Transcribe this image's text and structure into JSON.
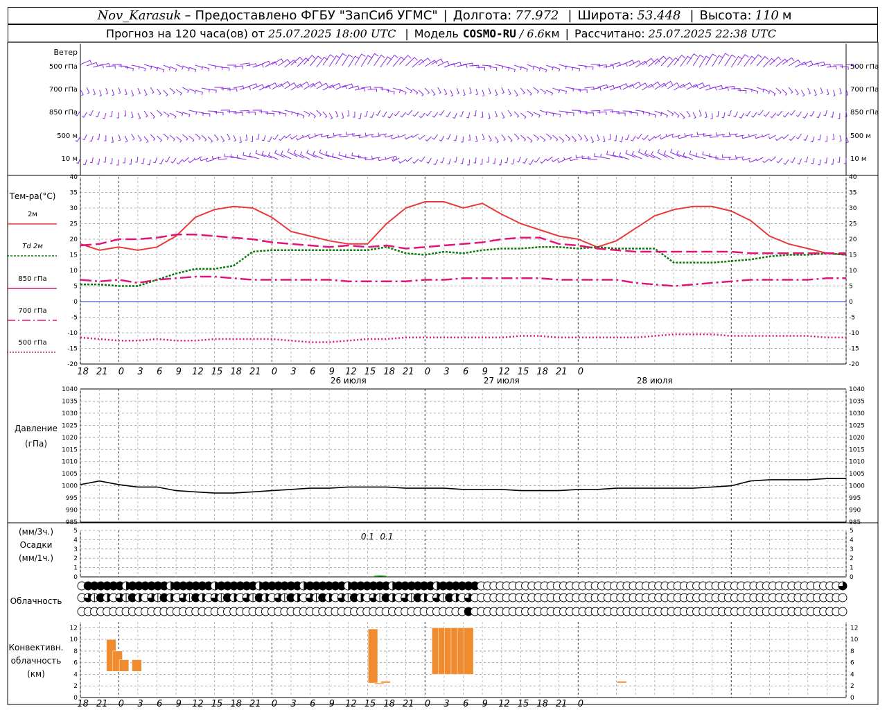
{
  "header": {
    "station": "Nov_Karasuk",
    "dash": "–",
    "provider": "Предоставлено ФГБУ \"ЗапСиб УГМС\"",
    "lon_label": "Долгота:",
    "lon_value": "77.972",
    "lat_label": "Широта:",
    "lat_value": "53.448",
    "alt_label": "Высота:",
    "alt_value": "110",
    "alt_unit": "м",
    "forecast_label": "Прогноз на 120 часа(ов) от",
    "forecast_start": "25.07.2025 18:00 UTC",
    "model_label": "Модель",
    "model_name": "COSMO-RU",
    "model_res": "/ 6.6",
    "model_res_unit": "км",
    "calc_label": "Рассчитано:",
    "calc_time": "25.07.2025 22:38 UTC"
  },
  "colors": {
    "t2m": "#e83a3a",
    "td2m": "#0a7a0a",
    "t850": "#e0147a",
    "t700": "#e0147a",
    "t500": "#e0147a",
    "wind": "#8a2be2",
    "pressure": "#000000",
    "precip": "#0a9a0a",
    "convective": "#f08c30",
    "zero_line": "#2030d0"
  },
  "x_axis": {
    "tick_labels": [
      "18",
      "21",
      "0",
      "3",
      "6",
      "9",
      "12",
      "15",
      "18",
      "21",
      "0",
      "3",
      "6",
      "9",
      "12",
      "15",
      "18",
      "21",
      "0",
      "3",
      "6",
      "9",
      "12",
      "15",
      "18",
      "21",
      "0"
    ],
    "day_labels": [
      "26 июля",
      "27 июля",
      "28 июля"
    ]
  },
  "wind_panel": {
    "title": "Ветер",
    "levels": [
      "500 гПа",
      "700 гПа",
      "850 гПа",
      "500 м",
      "10 м"
    ]
  },
  "temp_panel": {
    "title": "Тем-ра(°C)",
    "legend": [
      "2м",
      "Td 2м",
      "850 гПа",
      "700 гПа",
      "500 гПа"
    ],
    "yticks": [
      40,
      35,
      30,
      25,
      20,
      15,
      10,
      5,
      0,
      -5,
      -10,
      -15,
      -20
    ]
  },
  "pressure_panel": {
    "title": "Давление",
    "unit": "(гПа)",
    "yticks": [
      1040,
      1035,
      1030,
      1025,
      1020,
      1015,
      1010,
      1005,
      1000,
      995,
      990,
      985
    ]
  },
  "precip_panel": {
    "unit1": "(мм/3ч.)",
    "title": "Осадки",
    "unit2": "(мм/1ч.)",
    "yticks": [
      5,
      4,
      3,
      2,
      1,
      0
    ],
    "labels": [
      "0.1",
      "0.1"
    ]
  },
  "cloud_panel": {
    "title": "Облачность"
  },
  "conv_panel": {
    "title_lines": [
      "Конвективн.",
      "облачность",
      "(км)"
    ],
    "yticks": [
      12,
      10,
      8,
      6,
      4,
      2,
      0
    ]
  },
  "chart_data": [
    {
      "type": "line",
      "title": "Тем-ра(°C)",
      "x_hours_from_start": [
        0,
        3,
        6,
        9,
        12,
        15,
        18,
        21,
        24,
        27,
        30,
        33,
        36,
        39,
        42,
        45,
        48,
        51,
        54,
        57,
        60,
        63,
        66,
        69,
        72,
        75,
        78,
        81,
        84,
        87,
        90,
        93,
        96,
        99,
        102,
        105,
        108,
        111,
        114,
        117,
        120
      ],
      "ylim": [
        -20,
        40
      ],
      "series": [
        {
          "name": "2м",
          "values": [
            18.5,
            16.5,
            17.5,
            16.5,
            17.5,
            21,
            27,
            29.5,
            30.5,
            30,
            27,
            22.5,
            21,
            19.5,
            18.5,
            18.5,
            25,
            30,
            32,
            32,
            30,
            31.5,
            28,
            25,
            23,
            21,
            20,
            17.5,
            19.5,
            23.5,
            27.5,
            29.5,
            30.5,
            30.5,
            29,
            26,
            21,
            18.5,
            17,
            15.5,
            15
          ]
        },
        {
          "name": "Td 2м",
          "values": [
            5.5,
            5.5,
            5,
            5,
            7,
            9,
            10.5,
            10.5,
            11.5,
            16,
            16.5,
            16.5,
            16.5,
            16.5,
            16.5,
            16.5,
            17.5,
            15.5,
            15,
            16,
            15.5,
            16.5,
            17,
            17,
            17.5,
            17.5,
            17,
            17.5,
            17,
            17,
            17,
            12.5,
            12.5,
            12.5,
            13,
            13.5,
            14.5,
            15,
            15,
            15.5,
            15
          ]
        },
        {
          "name": "850 гПа",
          "values": [
            18,
            18.5,
            20,
            20,
            20.5,
            21.5,
            21.5,
            21,
            20.5,
            20,
            19,
            18.5,
            18,
            17.5,
            18,
            17.5,
            18,
            17,
            17.5,
            18,
            18.5,
            19,
            20,
            20.5,
            20.5,
            18.5,
            18,
            17,
            16.5,
            16,
            16,
            16,
            16,
            16,
            16,
            15.5,
            15.5,
            15.5,
            15.5,
            15.5,
            15.5
          ]
        },
        {
          "name": "700 гПа",
          "values": [
            7,
            6.5,
            7,
            6,
            7,
            7.5,
            8,
            8,
            7.5,
            7,
            7,
            7,
            7,
            7,
            6.5,
            6.5,
            6.5,
            6.5,
            7,
            7,
            7.5,
            7.5,
            7.5,
            7.5,
            7.5,
            7,
            7,
            7,
            7,
            6,
            5.5,
            5,
            5.5,
            6,
            6.5,
            7,
            7,
            7,
            7,
            7.5,
            7.5
          ]
        },
        {
          "name": "500 гПа",
          "values": [
            -11.5,
            -12,
            -12.5,
            -12.5,
            -12,
            -12.5,
            -12.5,
            -12,
            -12,
            -12,
            -12,
            -12.5,
            -13,
            -13,
            -12.5,
            -12,
            -12,
            -11.5,
            -11.5,
            -11.5,
            -11.5,
            -11.5,
            -11.5,
            -11,
            -11,
            -11.5,
            -11.5,
            -11.5,
            -11.5,
            -11.5,
            -11,
            -10.5,
            -10.5,
            -10.5,
            -11,
            -11,
            -11,
            -11,
            -11,
            -11.5,
            -11.5
          ]
        }
      ]
    },
    {
      "type": "line",
      "title": "Давление",
      "x_hours_from_start": [
        0,
        3,
        6,
        9,
        12,
        15,
        18,
        21,
        24,
        27,
        30,
        33,
        36,
        39,
        42,
        45,
        48,
        51,
        54,
        57,
        60,
        63,
        66,
        69,
        72,
        75,
        78,
        81,
        84,
        87,
        90,
        93,
        96,
        99,
        102,
        105,
        108,
        111,
        114,
        117,
        120
      ],
      "ylim": [
        985,
        1040
      ],
      "series": [
        {
          "name": "",
          "values": [
            1000.5,
            1002,
            1000.5,
            999.5,
            999.5,
            998,
            997.5,
            997,
            997,
            997.5,
            998,
            998.5,
            999,
            999,
            999.5,
            999.5,
            999.5,
            999,
            999,
            999,
            998.5,
            998.5,
            998.5,
            998,
            998,
            998,
            998.5,
            998.5,
            999,
            999,
            999,
            999,
            999,
            999.5,
            1000,
            1002,
            1002.5,
            1002.5,
            1002.5,
            1003,
            1003
          ]
        }
      ]
    },
    {
      "type": "bar",
      "title": "Осадки",
      "ylim": [
        0,
        5
      ],
      "labels_at_hours": [
        [
          45,
          "0.1"
        ],
        [
          48,
          "0.1"
        ]
      ],
      "series": [
        {
          "name": "",
          "x_hours_from_start": [
            46,
            47,
            48
          ],
          "values": [
            0.05,
            0.1,
            0.05
          ]
        }
      ]
    },
    {
      "type": "bar",
      "title": "Конвективн. облачность (км)",
      "ylim": [
        0,
        13
      ],
      "series": [
        {
          "name": "",
          "bars": [
            {
              "hour": 5,
              "bottom": 4.5,
              "top": 10
            },
            {
              "hour": 6,
              "bottom": 4.5,
              "top": 8
            },
            {
              "hour": 7,
              "bottom": 4.5,
              "top": 6.5
            },
            {
              "hour": 9,
              "bottom": 4.5,
              "top": 6.5
            },
            {
              "hour": 46,
              "bottom": 2.5,
              "top": 11.8
            },
            {
              "hour": 47,
              "bottom": 2.3,
              "top": 2.5
            },
            {
              "hour": 48,
              "bottom": 2.5,
              "top": 2.8
            },
            {
              "hour": 56,
              "bottom": 4,
              "top": 12
            },
            {
              "hour": 57,
              "bottom": 4,
              "top": 12
            },
            {
              "hour": 58,
              "bottom": 4,
              "top": 12
            },
            {
              "hour": 59,
              "bottom": 4,
              "top": 12
            },
            {
              "hour": 60,
              "bottom": 4,
              "top": 12
            },
            {
              "hour": 61,
              "bottom": 4,
              "top": 12
            },
            {
              "hour": 85,
              "bottom": 2.5,
              "top": 2.8
            }
          ]
        }
      ]
    }
  ]
}
